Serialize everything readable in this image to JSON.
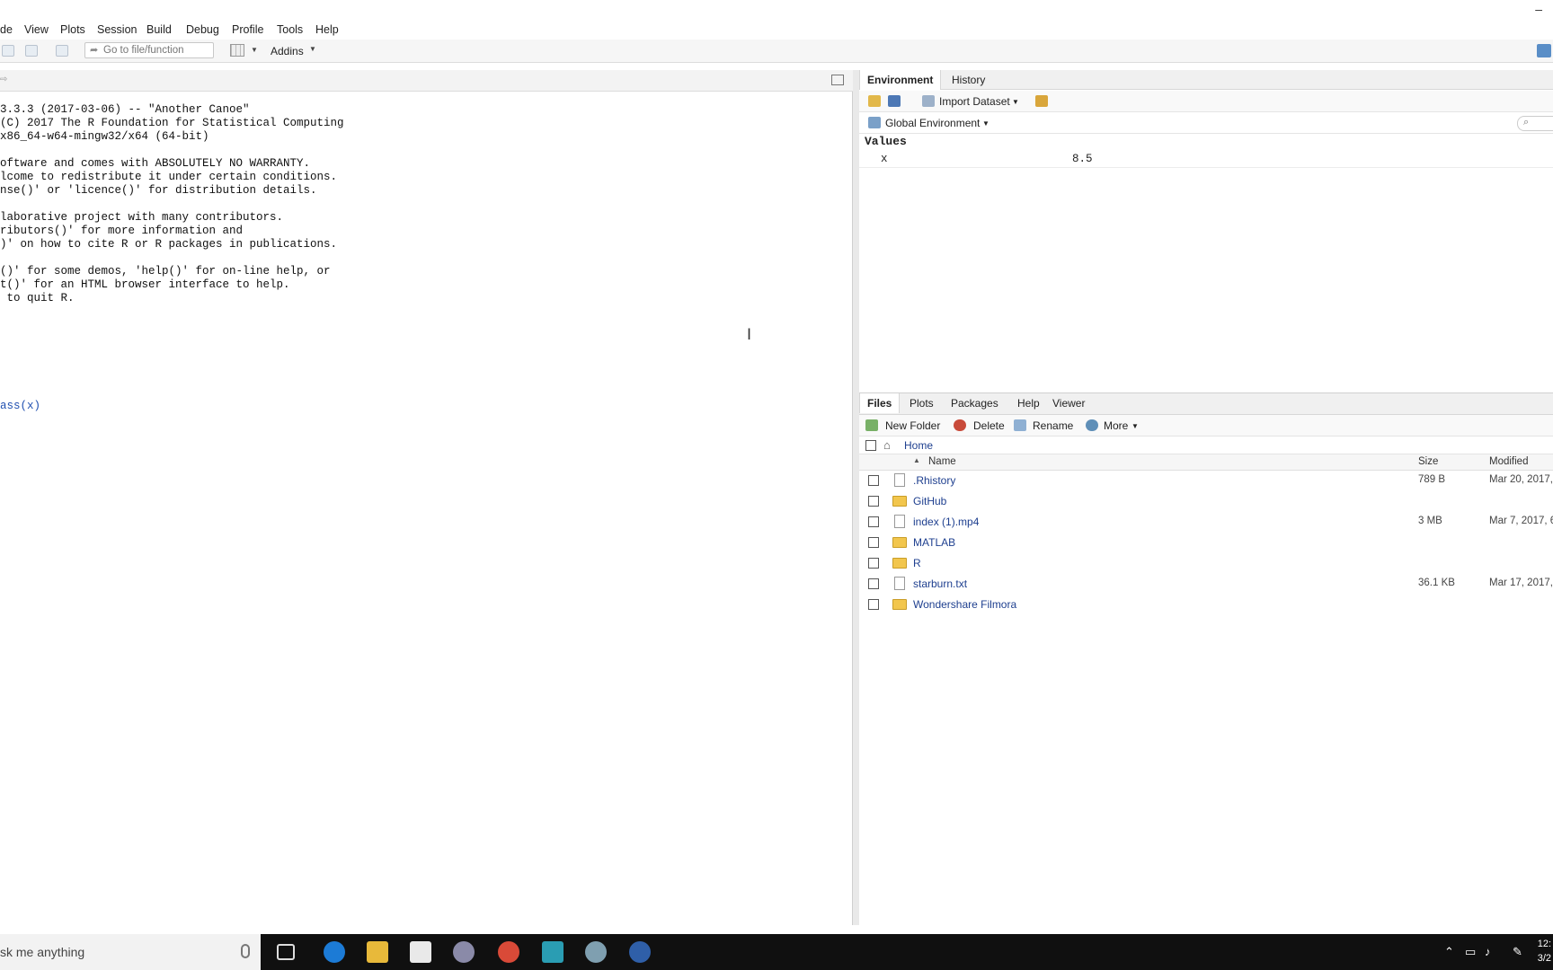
{
  "titlebar": {
    "minimize_glyph": "–"
  },
  "menu": [
    "de",
    "View",
    "Plots",
    "Session",
    "Build",
    "Debug",
    "Profile",
    "Tools",
    "Help"
  ],
  "toolbar": {
    "goto_placeholder": "Go to file/function",
    "addins_label": "Addins"
  },
  "console": {
    "lines": [
      "3.3.3 (2017-03-06) -- \"Another Canoe\"",
      "(C) 2017 The R Foundation for Statistical Computing",
      "x86_64-w64-mingw32/x64 (64-bit)",
      "",
      "oftware and comes with ABSOLUTELY NO WARRANTY.",
      "lcome to redistribute it under certain conditions.",
      "nse()' or 'licence()' for distribution details.",
      "",
      "laborative project with many contributors.",
      "ributors()' for more information and",
      ")' on how to cite R or R packages in publications.",
      "",
      "()' for some demos, 'help()' for on-line help, or",
      "t()' for an HTML browser interface to help.",
      " to quit R."
    ],
    "input": "ass(x)"
  },
  "environment": {
    "tabs": [
      "Environment",
      "History"
    ],
    "import_label": "Import Dataset",
    "scope_label": "Global Environment",
    "values_header": "Values",
    "rows": [
      {
        "name": "x",
        "value": "8.5"
      }
    ]
  },
  "files": {
    "tabs": [
      "Files",
      "Plots",
      "Packages",
      "Help",
      "Viewer"
    ],
    "new_folder": "New Folder",
    "delete": "Delete",
    "rename": "Rename",
    "more": "More",
    "path": "Home",
    "col_name": "Name",
    "col_size": "Size",
    "col_modified": "Modified",
    "rows": [
      {
        "name": ".Rhistory",
        "type": "file",
        "size": "789 B",
        "modified": "Mar 20, 2017,"
      },
      {
        "name": "GitHub",
        "type": "folder",
        "size": "",
        "modified": ""
      },
      {
        "name": "index (1).mp4",
        "type": "file",
        "size": "3 MB",
        "modified": "Mar 7, 2017, 6"
      },
      {
        "name": "MATLAB",
        "type": "folder",
        "size": "",
        "modified": ""
      },
      {
        "name": "R",
        "type": "folder",
        "size": "",
        "modified": ""
      },
      {
        "name": "starburn.txt",
        "type": "file",
        "size": "36.1 KB",
        "modified": "Mar 17, 2017,"
      },
      {
        "name": "Wondershare Filmora",
        "type": "folder",
        "size": "",
        "modified": ""
      }
    ]
  },
  "taskbar": {
    "search_text": "sk me anything",
    "clock_time": "12:",
    "clock_date": "3/2"
  },
  "colors": {
    "accent": "#1e3f8f",
    "folder": "#f2c64d",
    "taskbar": "#101010"
  }
}
